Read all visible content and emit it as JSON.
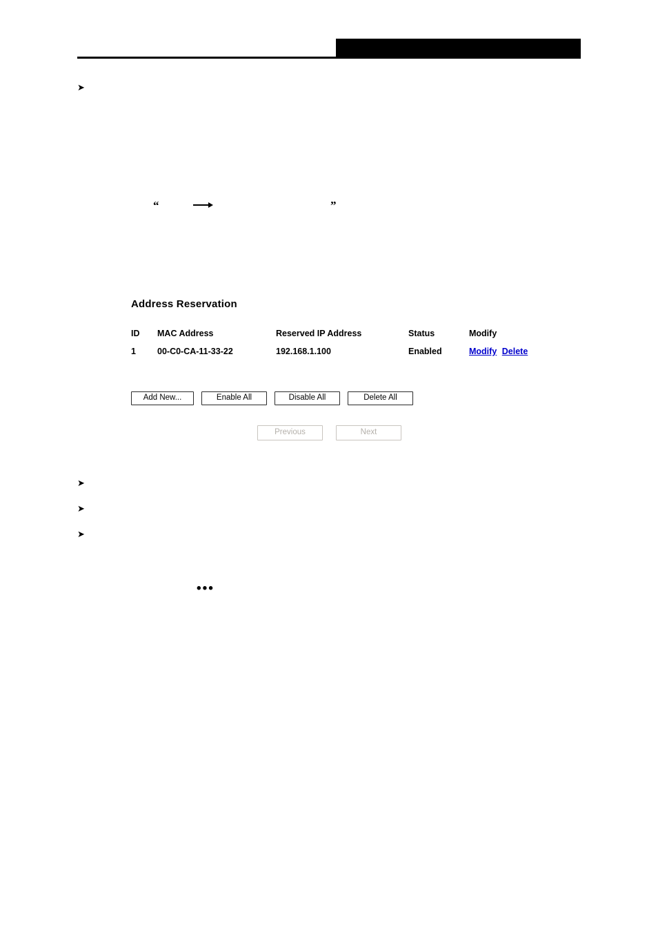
{
  "header": {
    "rule": "",
    "block": ""
  },
  "marks": {
    "quote_open": "“",
    "quote_close": "”",
    "ellipsis": "•••",
    "bullet_glyph": "➤"
  },
  "panel": {
    "title": "Address Reservation",
    "table": {
      "columns": [
        "ID",
        "MAC Address",
        "Reserved IP Address",
        "Status",
        "Modify"
      ],
      "rows": [
        {
          "id": "1",
          "mac": "00-C0-CA-11-33-22",
          "ip": "192.168.1.100",
          "status": "Enabled",
          "modify_edit": "Modify",
          "modify_delete": "Delete"
        }
      ]
    },
    "buttons": {
      "add_new": "Add New...",
      "enable_all": "Enable All",
      "disable_all": "Disable All",
      "delete_all": "Delete All",
      "previous": "Previous",
      "next": "Next"
    }
  },
  "colors": {
    "link": "#0000cc",
    "disabled_text": "#b4b0aa",
    "rule": "#000000"
  }
}
